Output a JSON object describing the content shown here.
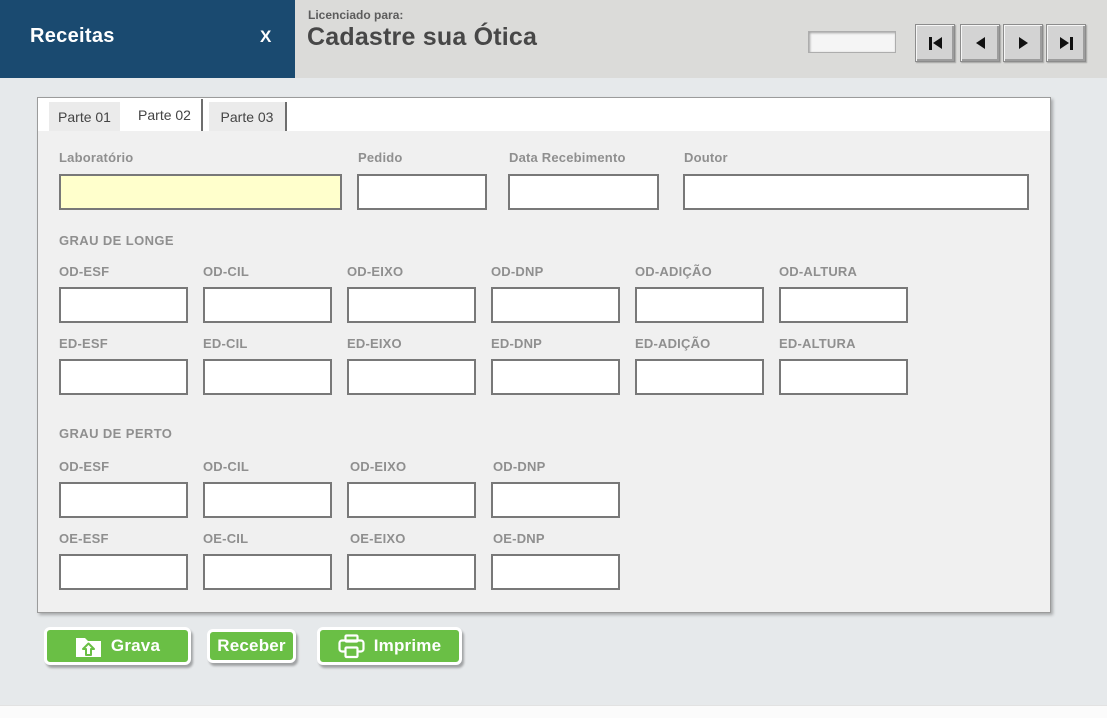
{
  "window": {
    "title": "Receitas",
    "close_label": "X"
  },
  "header": {
    "licensed_caption": "Licenciado para:",
    "licensed_name": "Cadastre sua Ótica",
    "record_value": ""
  },
  "nav": {
    "first_icon": "first-record-icon",
    "prev_icon": "previous-record-icon",
    "next_icon": "next-record-icon",
    "last_icon": "last-record-icon"
  },
  "tabs": [
    {
      "label": "Parte 01",
      "active": false
    },
    {
      "label": "Parte 02",
      "active": true
    },
    {
      "label": "Parte 03",
      "active": false
    }
  ],
  "fields": {
    "laboratorio": {
      "label": "Laboratório",
      "value": ""
    },
    "pedido": {
      "label": "Pedido",
      "value": ""
    },
    "data_recebimento": {
      "label": "Data Recebimento",
      "value": ""
    },
    "doutor": {
      "label": "Doutor",
      "value": ""
    }
  },
  "grau_longe": {
    "title": "GRAU DE LONGE",
    "row_od": [
      "OD-ESF",
      "OD-CIL",
      "OD-EIXO",
      "OD-DNP",
      "OD-ADIÇÃO",
      "OD-ALTURA"
    ],
    "row_ed": [
      "ED-ESF",
      "ED-CIL",
      "ED-EIXO",
      "ED-DNP",
      "ED-ADIÇÃO",
      "ED-ALTURA"
    ],
    "values_od": [
      "",
      "",
      "",
      "",
      "",
      ""
    ],
    "values_ed": [
      "",
      "",
      "",
      "",
      "",
      ""
    ]
  },
  "grau_perto": {
    "title": "GRAU DE PERTO",
    "row_od": [
      "OD-ESF",
      "OD-CIL",
      "OD-EIXO",
      "OD-DNP"
    ],
    "row_oe": [
      "OE-ESF",
      "OE-CIL",
      "OE-EIXO",
      "OE-DNP"
    ],
    "values_od": [
      "",
      "",
      "",
      ""
    ],
    "values_oe": [
      "",
      "",
      "",
      ""
    ]
  },
  "actions": {
    "grava": {
      "label": "Grava",
      "icon": "folder-upload-icon"
    },
    "receber": {
      "label": "Receber"
    },
    "imprime": {
      "label": "Imprime",
      "icon": "printer-icon"
    }
  },
  "colors": {
    "header_blue": "#1A4A70",
    "header_gray": "#DBDBD9",
    "action_green": "#6ABF45",
    "field_highlight": "#FFFFCC"
  }
}
